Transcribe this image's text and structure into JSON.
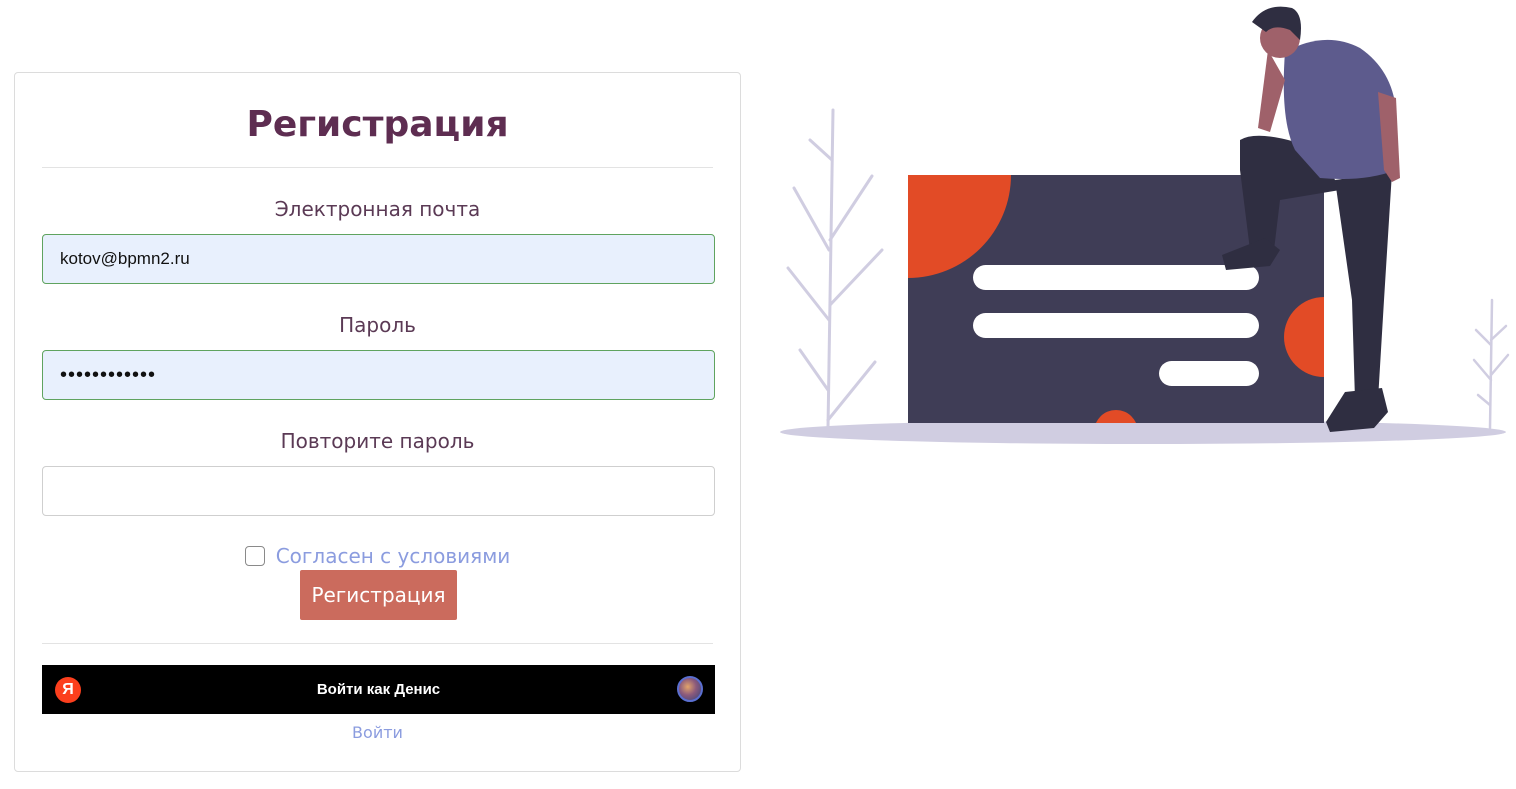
{
  "form": {
    "title": "Регистрация",
    "email_label": "Электронная почта",
    "email_value": "kotov@bpmn2.ru",
    "password_label": "Пароль",
    "password_value": "••••••••••••",
    "repeat_password_label": "Повторите пароль",
    "repeat_password_value": "",
    "agree_label": "Согласен с условиями",
    "agree_checked": false,
    "submit_label": "Регистрация"
  },
  "yandex": {
    "logo_letter": "Я",
    "login_as_label": "Войти как Денис"
  },
  "login_link": "Войти",
  "colors": {
    "title": "#5e2d51",
    "button": "#cb6b5d",
    "link": "#8b9cdf",
    "autofill_bg": "#e8f0fd",
    "illustration_accent": "#e24b26",
    "illustration_dark": "#3f3d56",
    "shirt": "#5d5b8d"
  }
}
